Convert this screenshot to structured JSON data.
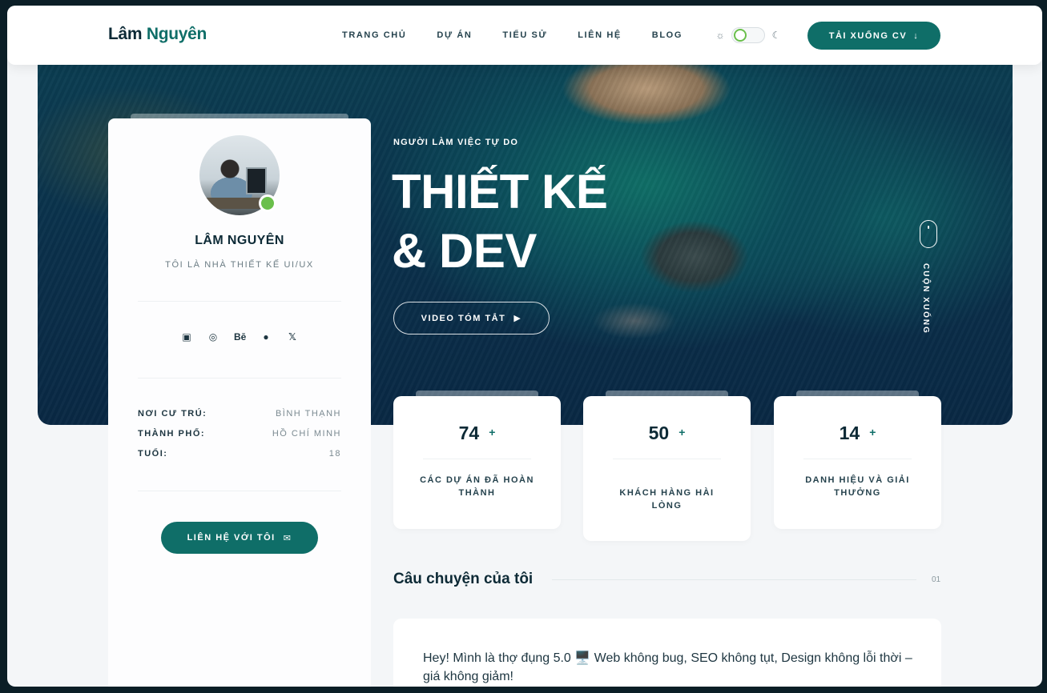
{
  "header": {
    "logo_first": "Lâm",
    "logo_second": "Nguyên",
    "nav": [
      "TRANG CHỦ",
      "DỰ ÁN",
      "TIỂU SỬ",
      "LIÊN HỆ",
      "BLOG"
    ],
    "cv_button": "TẢI XUỐNG CV",
    "theme_toggle_on": false
  },
  "profile": {
    "name": "LÂM NGUYÊN",
    "role": "TÔI LÀ NHÀ THIẾT KẾ UI/UX",
    "socials": [
      "linkedin-icon",
      "dribbble-icon",
      "behance-icon",
      "github-icon",
      "x-icon"
    ],
    "behance_glyph": "Bē",
    "x_glyph": "𝕏",
    "info": [
      {
        "key": "NƠI CƯ TRÚ:",
        "value": "BÌNH THẠNH"
      },
      {
        "key": "THÀNH PHỐ:",
        "value": "HỒ CHÍ MINH"
      },
      {
        "key": "TUỔI:",
        "value": "18"
      }
    ],
    "contact_button": "LIÊN HỆ VỚI TÔI"
  },
  "hero": {
    "eyebrow": "NGƯỜI LÀM VIỆC TỰ DO",
    "headline_line1": "THIẾT KẾ",
    "headline_line2": "& DEV",
    "video_button": "VIDEO TÓM TẮT",
    "scroll_label": "CUỘN XUỐNG"
  },
  "stats": [
    {
      "value": "74",
      "plus": "+",
      "label": "CÁC DỰ ÁN ĐÃ HOÀN THÀNH"
    },
    {
      "value": "50",
      "plus": "+",
      "label": "KHÁCH HÀNG HÀI LÒNG"
    },
    {
      "value": "14",
      "plus": "+",
      "label": "DANH HIỆU VÀ GIẢI THƯỞNG"
    }
  ],
  "story": {
    "title": "Câu chuyện của tôi",
    "number": "01",
    "text": "Hey! Mình là thợ đụng 5.0 🖥️ Web không bug, SEO không tụt, Design không lỗi thời – giá không giảm!"
  },
  "colors": {
    "accent": "#0f6e68",
    "online": "#6abf4b",
    "text_dark": "#0d2a36"
  }
}
